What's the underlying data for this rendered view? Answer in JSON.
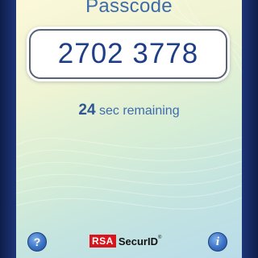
{
  "app": {
    "title": "Passcode",
    "passcode": "2702 3778",
    "timer": {
      "seconds": "24",
      "label": "sec remaining"
    },
    "brand": {
      "logo": "RSA",
      "product": "SecurID",
      "trademark": "®"
    },
    "buttons": {
      "help": "?",
      "info": "i"
    }
  },
  "colors": {
    "frame": "#14265c",
    "accent_text": "#3e6bab",
    "passcode_text": "#1e3f85",
    "brand_red": "#d8141c"
  }
}
